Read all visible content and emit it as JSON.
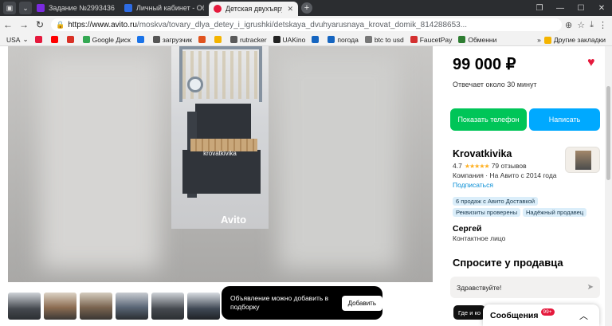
{
  "browser": {
    "tabs": [
      {
        "title": "Задание №2993436 - про",
        "color": "#7b2ae0"
      },
      {
        "title": "Личный кабинет - Объяв",
        "color": "#2d6be4"
      },
      {
        "title": "Детская двухъярусная",
        "color": "#e5193c",
        "active": true
      }
    ],
    "new_tab_label": "+",
    "url_host": "https://www.avito.ru",
    "url_path": "/moskva/tovary_dlya_detey_i_igrushki/detskaya_dvuhyarusnaya_krovat_domik_814288653..."
  },
  "bookmarks": [
    {
      "label": "USA",
      "color": "#666"
    },
    {
      "label": "",
      "color": "#e5193c"
    },
    {
      "label": "",
      "color": "#ff0000"
    },
    {
      "label": "",
      "color": "#1a73e8"
    },
    {
      "label": "Google Диск",
      "color": "#34a853"
    },
    {
      "label": "",
      "color": "#1a73e8"
    },
    {
      "label": "загрузчик",
      "color": "#555"
    },
    {
      "label": "",
      "color": "#e0531f"
    },
    {
      "label": "",
      "color": "#f4b400"
    },
    {
      "label": "rutracker",
      "color": "#5a5a5a"
    },
    {
      "label": "UAKino",
      "color": "#222"
    },
    {
      "label": "",
      "color": "#1565c0"
    },
    {
      "label": "погода",
      "color": "#1565c0"
    },
    {
      "label": "btc to usd",
      "color": "#777"
    },
    {
      "label": "FaucetPay",
      "color": "#d32f2f"
    },
    {
      "label": "Обменни",
      "color": "#2e7d32"
    },
    {
      "label": "",
      "color": "#f4b400"
    }
  ],
  "bookmarks_other": "Другие закладки",
  "listing": {
    "price": "99 000 ₽",
    "reply_time": "Отвечает около 30 минут",
    "show_phone_label": "Показать телефон",
    "write_label": "Написать",
    "photo_watermark": "krovatkivika",
    "photo_logo": "Avito",
    "thumbnail_count": 6
  },
  "toast": {
    "text": "Объявление можно добавить в подборку",
    "button": "Добавить"
  },
  "seller": {
    "name": "Krovatkivika",
    "rating": "4.7",
    "stars": "★★★★★",
    "reviews": "79 отзывов",
    "company_line": "Компания · На Авито с 2014 года",
    "subscribe": "Подписаться",
    "badges": [
      "6 продаж с Авито Доставкой",
      "Реквизиты проверены",
      "Надёжный продавец"
    ]
  },
  "contact": {
    "name": "Сергей",
    "role": "Контактное лицо"
  },
  "ask": {
    "title": "Спросите у продавца",
    "input_value": "Здравствуйте!",
    "chip": "Где и ко"
  },
  "messages": {
    "label": "Сообщения",
    "count": "99+"
  }
}
